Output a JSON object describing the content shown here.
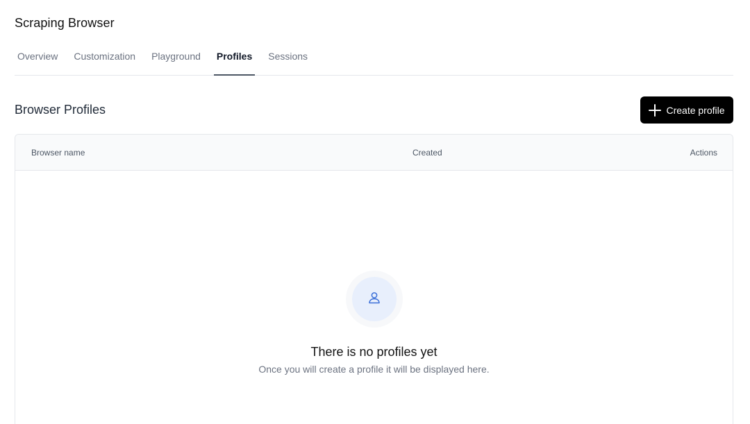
{
  "app": {
    "title": "Scraping Browser"
  },
  "tabs": [
    {
      "label": "Overview",
      "active": false
    },
    {
      "label": "Customization",
      "active": false
    },
    {
      "label": "Playground",
      "active": false
    },
    {
      "label": "Profiles",
      "active": true
    },
    {
      "label": "Sessions",
      "active": false
    }
  ],
  "section": {
    "title": "Browser Profiles",
    "create_button_label": "Create profile",
    "create_button_icon": "plus-icon"
  },
  "table": {
    "columns": [
      "Browser name",
      "Created",
      "Actions"
    ],
    "rows": []
  },
  "empty_state": {
    "icon": "user-icon",
    "title": "There is no profiles yet",
    "subtitle": "Once you will create a profile it will be displayed here."
  },
  "colors": {
    "accent_icon": "#3b6fd8",
    "button_bg": "#000000",
    "active_tab_underline": "#4b5563"
  }
}
